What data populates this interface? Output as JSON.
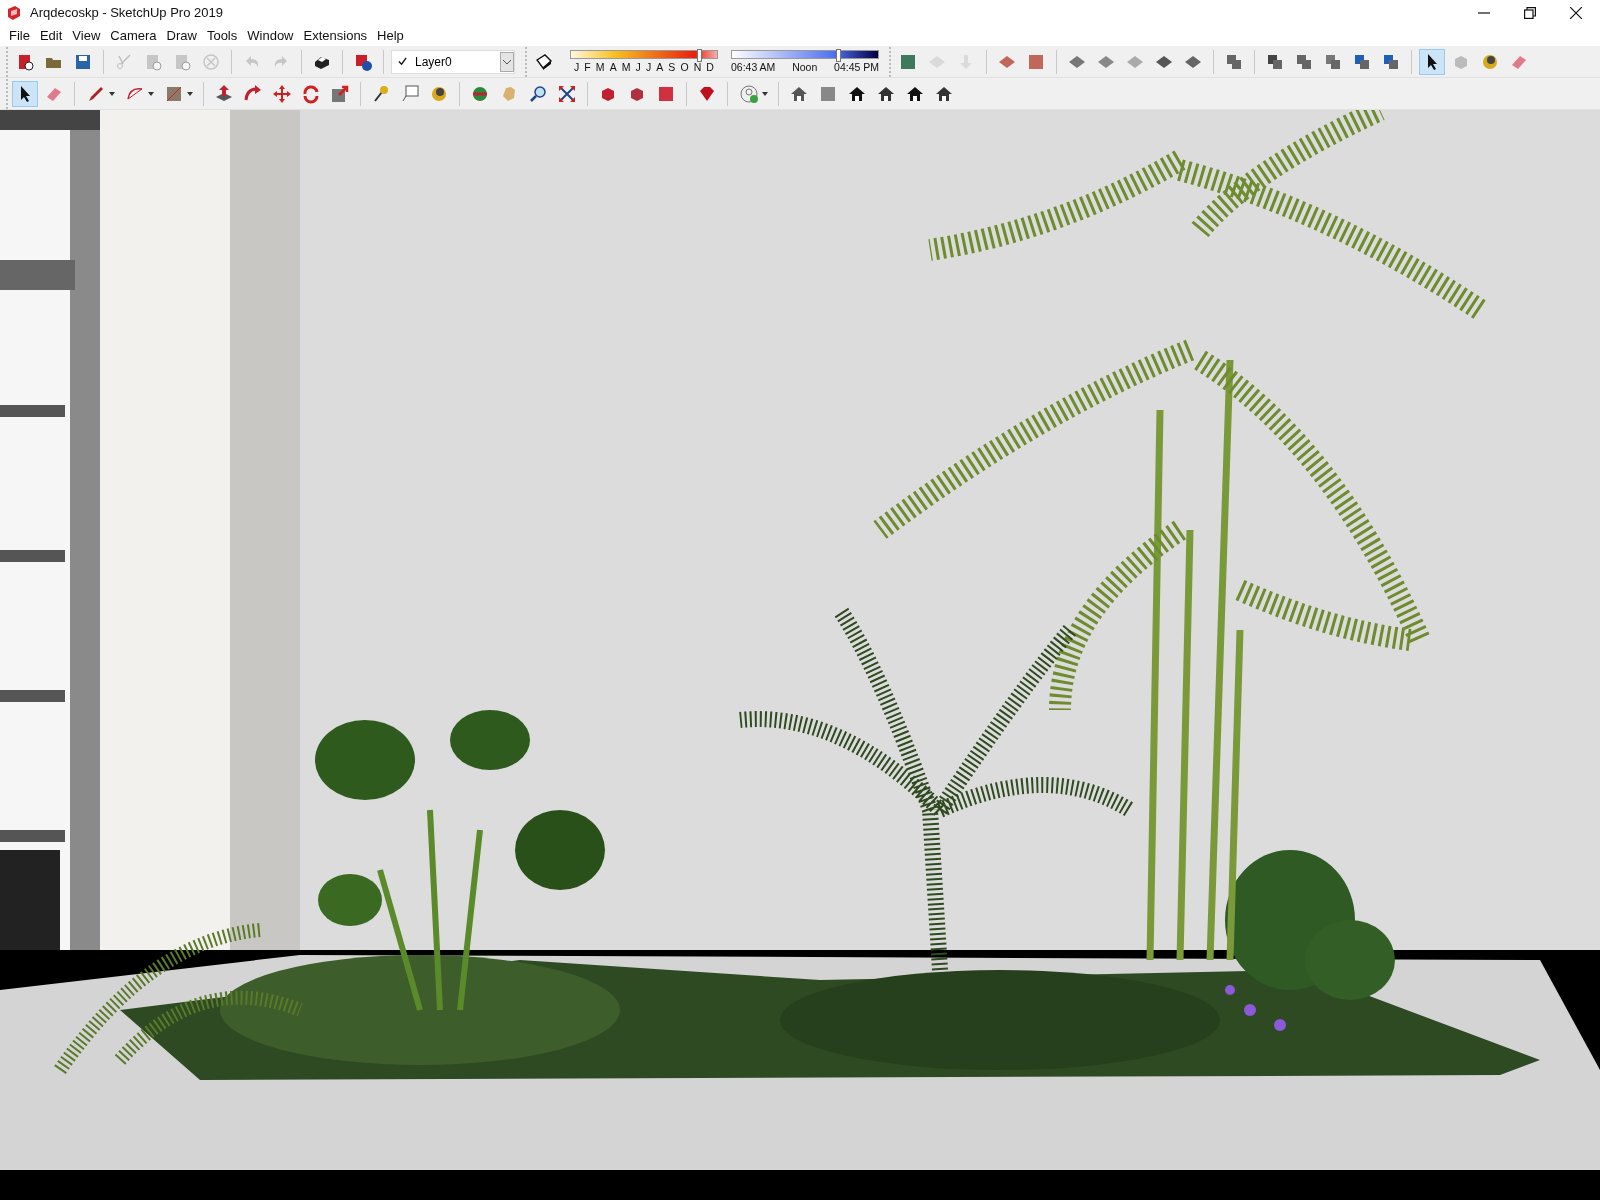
{
  "window": {
    "title": "Arqdecoskp - SketchUp Pro 2019"
  },
  "menu": [
    "File",
    "Edit",
    "View",
    "Camera",
    "Draw",
    "Tools",
    "Window",
    "Extensions",
    "Help"
  ],
  "toolbar_row_1": {
    "left_groups": [
      [
        {
          "kind": "new",
          "selected": false,
          "disabled": false
        },
        {
          "kind": "open",
          "selected": false,
          "disabled": false
        },
        {
          "kind": "save",
          "selected": false,
          "disabled": false
        }
      ],
      [
        {
          "kind": "cut",
          "selected": false,
          "disabled": true
        },
        {
          "kind": "copy",
          "selected": false,
          "disabled": true
        },
        {
          "kind": "paste",
          "selected": false,
          "disabled": true
        },
        {
          "kind": "erase-selection",
          "selected": false,
          "disabled": true
        }
      ],
      [
        {
          "kind": "undo",
          "selected": false,
          "disabled": true
        },
        {
          "kind": "redo",
          "selected": false,
          "disabled": true
        }
      ],
      [
        {
          "kind": "print",
          "selected": false,
          "disabled": false
        }
      ],
      [
        {
          "kind": "model-info",
          "selected": false,
          "disabled": false
        }
      ]
    ],
    "layer": {
      "value": "Layer0"
    },
    "shadow": {
      "months": [
        "J",
        "F",
        "M",
        "A",
        "M",
        "J",
        "J",
        "A",
        "S",
        "O",
        "N",
        "D"
      ],
      "date": {
        "level": 0.86
      },
      "time_start": "06:43 AM",
      "time_mid": "Noon",
      "time_end": "04:45 PM",
      "time": {
        "level": 0.71
      }
    },
    "right_groups": [
      [
        {
          "kind": "photo-texture",
          "selected": false,
          "disabled": false
        },
        {
          "kind": "add-location",
          "selected": false,
          "disabled": true
        },
        {
          "kind": "terrain",
          "selected": false,
          "disabled": true
        }
      ],
      [
        {
          "kind": "sandbox-contours",
          "selected": false,
          "disabled": false
        },
        {
          "kind": "sandbox-scratch",
          "selected": false,
          "disabled": false
        }
      ],
      [
        {
          "kind": "smoove",
          "selected": false,
          "disabled": false
        },
        {
          "kind": "stamp",
          "selected": false,
          "disabled": false
        },
        {
          "kind": "drape",
          "selected": false,
          "disabled": false
        },
        {
          "kind": "add-detail",
          "selected": false,
          "disabled": false
        },
        {
          "kind": "flip-edge",
          "selected": false,
          "disabled": false
        }
      ],
      [
        {
          "kind": "solid-outer",
          "selected": false,
          "disabled": false
        }
      ],
      [
        {
          "kind": "solid-intersect",
          "selected": false,
          "disabled": false
        },
        {
          "kind": "solid-union",
          "selected": false,
          "disabled": false
        },
        {
          "kind": "solid-subtract",
          "selected": false,
          "disabled": false
        },
        {
          "kind": "solid-trim",
          "selected": false,
          "disabled": false
        },
        {
          "kind": "solid-split",
          "selected": false,
          "disabled": false
        }
      ],
      [
        {
          "kind": "select",
          "selected": true,
          "disabled": false
        },
        {
          "kind": "component",
          "selected": false,
          "disabled": false
        },
        {
          "kind": "paint",
          "selected": false,
          "disabled": false
        },
        {
          "kind": "eraser",
          "selected": false,
          "disabled": false
        }
      ]
    ]
  },
  "toolbar_row_2": [
    [
      {
        "kind": "select",
        "selected": true,
        "disabled": false,
        "menu": false
      },
      {
        "kind": "eraser",
        "selected": false,
        "disabled": false,
        "menu": false
      }
    ],
    [
      {
        "kind": "pencil",
        "selected": false,
        "disabled": false,
        "menu": true
      },
      {
        "kind": "arc",
        "selected": false,
        "disabled": false,
        "menu": true
      },
      {
        "kind": "rectangle",
        "selected": false,
        "disabled": false,
        "menu": true
      }
    ],
    [
      {
        "kind": "push-pull",
        "selected": false,
        "disabled": false,
        "menu": false
      },
      {
        "kind": "follow-me",
        "selected": false,
        "disabled": false,
        "menu": false
      },
      {
        "kind": "move",
        "selected": false,
        "disabled": false,
        "menu": false
      },
      {
        "kind": "rotate",
        "selected": false,
        "disabled": false,
        "menu": false
      },
      {
        "kind": "scale",
        "selected": false,
        "disabled": false,
        "menu": false
      }
    ],
    [
      {
        "kind": "tape",
        "selected": false,
        "disabled": false,
        "menu": false
      },
      {
        "kind": "text",
        "selected": false,
        "disabled": false,
        "menu": false
      },
      {
        "kind": "paint",
        "selected": false,
        "disabled": false,
        "menu": false
      }
    ],
    [
      {
        "kind": "orbit",
        "selected": false,
        "disabled": false,
        "menu": false
      },
      {
        "kind": "pan",
        "selected": false,
        "disabled": false,
        "menu": false
      },
      {
        "kind": "zoom",
        "selected": false,
        "disabled": false,
        "menu": false
      },
      {
        "kind": "zoom-extents",
        "selected": false,
        "disabled": false,
        "menu": false
      }
    ],
    [
      {
        "kind": "warehouse",
        "selected": false,
        "disabled": false,
        "menu": false
      },
      {
        "kind": "warehouse-share",
        "selected": false,
        "disabled": false,
        "menu": false
      },
      {
        "kind": "warehouse-upload",
        "selected": false,
        "disabled": false,
        "menu": false
      }
    ],
    [
      {
        "kind": "extension-warehouse",
        "selected": false,
        "disabled": false,
        "menu": false
      }
    ],
    [
      {
        "kind": "account",
        "selected": false,
        "disabled": false,
        "menu": true
      }
    ],
    [
      {
        "kind": "view-iso",
        "selected": false,
        "disabled": false,
        "menu": false
      },
      {
        "kind": "view-top",
        "selected": false,
        "disabled": false,
        "menu": false
      },
      {
        "kind": "view-front",
        "selected": false,
        "disabled": false,
        "menu": false
      },
      {
        "kind": "view-right",
        "selected": false,
        "disabled": false,
        "menu": false
      },
      {
        "kind": "view-back",
        "selected": false,
        "disabled": false,
        "menu": false
      },
      {
        "kind": "view-left",
        "selected": false,
        "disabled": false,
        "menu": false
      }
    ]
  ]
}
